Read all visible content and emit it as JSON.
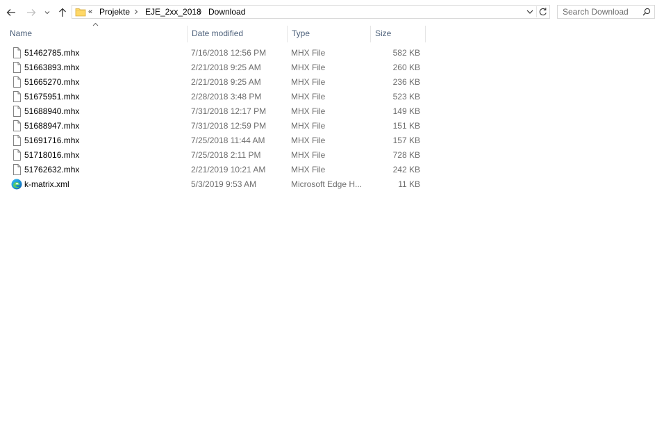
{
  "navigation": {
    "back_icon": "arrow-left-icon",
    "forward_icon": "arrow-right-icon",
    "recent_icon": "chevron-down-icon",
    "up_icon": "arrow-up-icon"
  },
  "address_bar": {
    "overflow_label": "«",
    "breadcrumbs": [
      "Projekte",
      "EJE_2xx_2018",
      "Download"
    ]
  },
  "search": {
    "placeholder": "Search Download"
  },
  "columns": {
    "name": "Name",
    "date_modified": "Date modified",
    "type": "Type",
    "size": "Size"
  },
  "files": [
    {
      "name": "51462785.mhx",
      "date": "7/16/2018 12:56 PM",
      "type": "MHX File",
      "size": "582 KB",
      "icon": "document-icon"
    },
    {
      "name": "51663893.mhx",
      "date": "2/21/2018 9:25 AM",
      "type": "MHX File",
      "size": "260 KB",
      "icon": "document-icon"
    },
    {
      "name": "51665270.mhx",
      "date": "2/21/2018 9:25 AM",
      "type": "MHX File",
      "size": "236 KB",
      "icon": "document-icon"
    },
    {
      "name": "51675951.mhx",
      "date": "2/28/2018 3:48 PM",
      "type": "MHX File",
      "size": "523 KB",
      "icon": "document-icon"
    },
    {
      "name": "51688940.mhx",
      "date": "7/31/2018 12:17 PM",
      "type": "MHX File",
      "size": "149 KB",
      "icon": "document-icon"
    },
    {
      "name": "51688947.mhx",
      "date": "7/31/2018 12:59 PM",
      "type": "MHX File",
      "size": "151 KB",
      "icon": "document-icon"
    },
    {
      "name": "51691716.mhx",
      "date": "7/25/2018 11:44 AM",
      "type": "MHX File",
      "size": "157 KB",
      "icon": "document-icon"
    },
    {
      "name": "51718016.mhx",
      "date": "7/25/2018 2:11 PM",
      "type": "MHX File",
      "size": "728 KB",
      "icon": "document-icon"
    },
    {
      "name": "51762632.mhx",
      "date": "2/21/2019 10:21 AM",
      "type": "MHX File",
      "size": "242 KB",
      "icon": "document-icon"
    },
    {
      "name": "k-matrix.xml",
      "date": "5/3/2019 9:53 AM",
      "type": "Microsoft Edge H...",
      "size": "11 KB",
      "icon": "edge-icon"
    }
  ],
  "colors": {
    "header_text": "#4c607a",
    "secondary_text": "#6d6d6d",
    "folder_yellow": "#ffd867"
  }
}
